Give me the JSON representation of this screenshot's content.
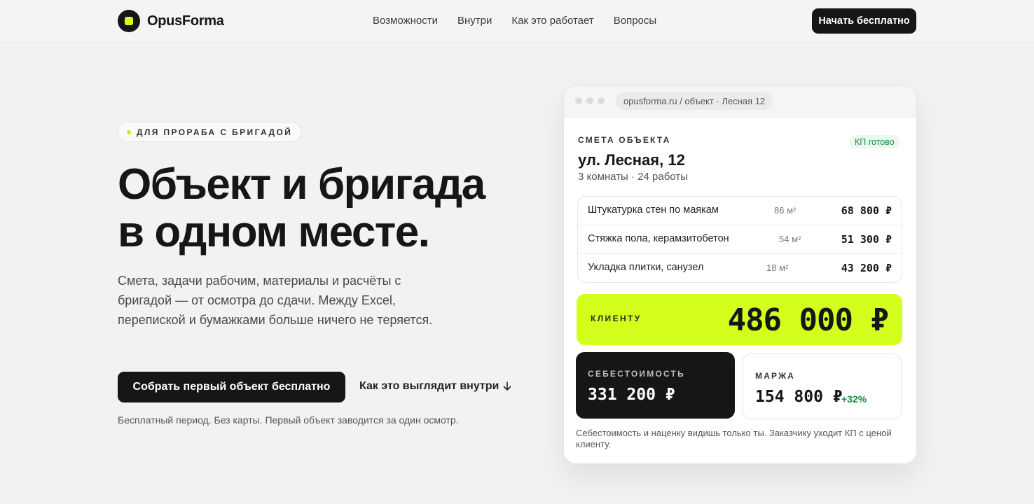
{
  "header": {
    "logo_text": "OpusForma",
    "nav": [
      "Возможности",
      "Внутри",
      "Как это работает",
      "Вопросы"
    ],
    "cta": "Начать бесплатно"
  },
  "hero": {
    "badge": "ДЛЯ ПРОРАБА С БРИГАДОЙ",
    "title": "Объект и  бригада\nв  одном месте.",
    "description": "Смета, задачи рабочим, материалы и  расчёты с  бригадой — от  осмотра до  сдачи. Между Excel, перепиской и  бумажками больше ничего не  теряется.",
    "primary_cta": "Собрать первый объект бесплатно",
    "secondary_cta": "Как это выглядит внутри",
    "secondary_cta_icon": "arrow-down-icon",
    "note": "Бесплатный период. Без карты. Первый объект заводится за  один осмотр."
  },
  "card": {
    "url": "opusforma.ru / объект · Лесная 12",
    "estimate_label": "СМЕТА ОБЪЕКТА",
    "status": "КП готово",
    "address": "ул.  Лесная, 12",
    "summary": "3  комнаты · 24  работы",
    "items": [
      {
        "name": "Штукатурка стен по маякам",
        "qty": "86 м²",
        "price": "68 800 ₽"
      },
      {
        "name": "Стяжка пола, керамзитобетон",
        "qty": "54 м²",
        "price": "51 300 ₽"
      },
      {
        "name": "Укладка плитки, санузел",
        "qty": "18 м²",
        "price": "43 200 ₽"
      }
    ],
    "client_label": "КЛИЕНТУ",
    "client_value": "486 000 ₽",
    "cost_label": "СЕБЕСТОИМОСТЬ",
    "cost_value": "331 200 ₽",
    "margin_label": "МАРЖА",
    "margin_value": "154 800 ₽",
    "margin_pct": "+32%",
    "footnote": "Себестоимость и  наценку видишь только ты. Заказчику уходит КП с  ценой клиенту."
  },
  "colors": {
    "accent": "#d4ff1c",
    "dark": "#161616",
    "success": "#1e8a46"
  }
}
